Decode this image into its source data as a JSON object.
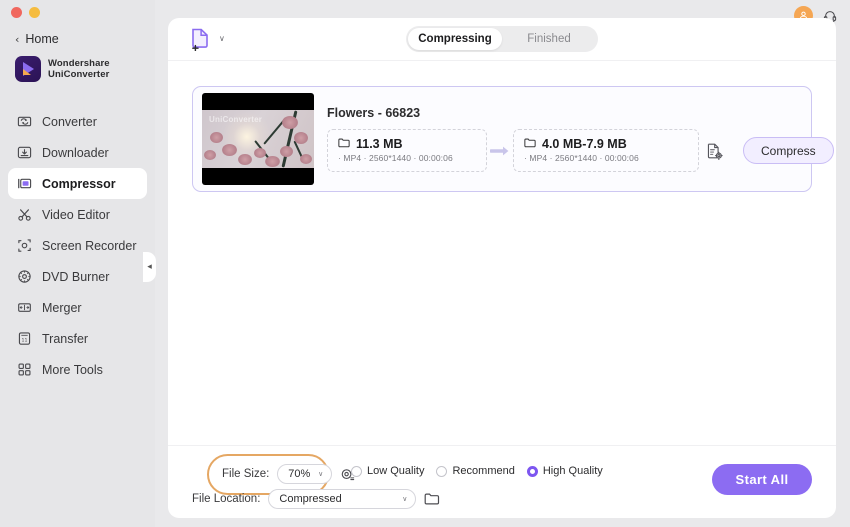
{
  "window": {
    "controls": [
      "close",
      "minimize"
    ]
  },
  "sidebar": {
    "back_label": "Home",
    "brand_line1": "Wondershare",
    "brand_line2": "UniConverter",
    "collapse_glyph": "◂",
    "items": [
      {
        "label": "Converter",
        "icon": "converter-icon",
        "active": false
      },
      {
        "label": "Downloader",
        "icon": "downloader-icon",
        "active": false
      },
      {
        "label": "Compressor",
        "icon": "compressor-icon",
        "active": true
      },
      {
        "label": "Video Editor",
        "icon": "scissors-icon",
        "active": false
      },
      {
        "label": "Screen Recorder",
        "icon": "screen-recorder-icon",
        "active": false
      },
      {
        "label": "DVD Burner",
        "icon": "disc-icon",
        "active": false
      },
      {
        "label": "Merger",
        "icon": "merge-icon",
        "active": false
      },
      {
        "label": "Transfer",
        "icon": "transfer-icon",
        "active": false
      },
      {
        "label": "More Tools",
        "icon": "grid-icon",
        "active": false
      }
    ]
  },
  "header": {
    "add_file_icon": "add-file-icon",
    "add_file_caret": "∨",
    "tabs": [
      {
        "label": "Compressing",
        "active": true
      },
      {
        "label": "Finished",
        "active": false
      }
    ],
    "account_icon": "user-avatar-icon",
    "support_icon": "headset-icon"
  },
  "file_card": {
    "title": "Flowers - 66823",
    "thumbnail_watermark": "UniConverter",
    "source": {
      "size": "11.3 MB",
      "format": "MP4",
      "resolution": "2560*1440",
      "duration": "00:00:06",
      "meta": "· MP4   · 2560*1440   · 00:00:06"
    },
    "arrow_icon": "arrow-right-icon",
    "output": {
      "size": "4.0 MB-7.9 MB",
      "format": "MP4",
      "resolution": "2560*1440",
      "duration": "00:00:06",
      "meta": "· MP4   · 2560*1440   · 00:00:06"
    },
    "settings_icon": "file-settings-icon",
    "compress_button": "Compress"
  },
  "bottom": {
    "file_size_label": "File Size:",
    "file_size_value": "70%",
    "file_size_caret": "∨",
    "preview_icon": "preview-compare-icon",
    "file_location_label": "File Location:",
    "file_location_value": "Compressed",
    "file_location_caret": "∨",
    "folder_icon": "folder-icon",
    "quality_options": [
      {
        "label": "Low Quality",
        "selected": false
      },
      {
        "label": "Recommend",
        "selected": false
      },
      {
        "label": "High Quality",
        "selected": true
      }
    ],
    "start_all_label": "Start  All"
  },
  "colors": {
    "accent_purple": "#8c6cf2",
    "card_border": "#cdc7f2",
    "highlight_orange": "#e5a763",
    "avatar_orange": "#f5a653",
    "sidebar_bg": "#e6e6e8",
    "panel_bg": "#ffffff"
  }
}
